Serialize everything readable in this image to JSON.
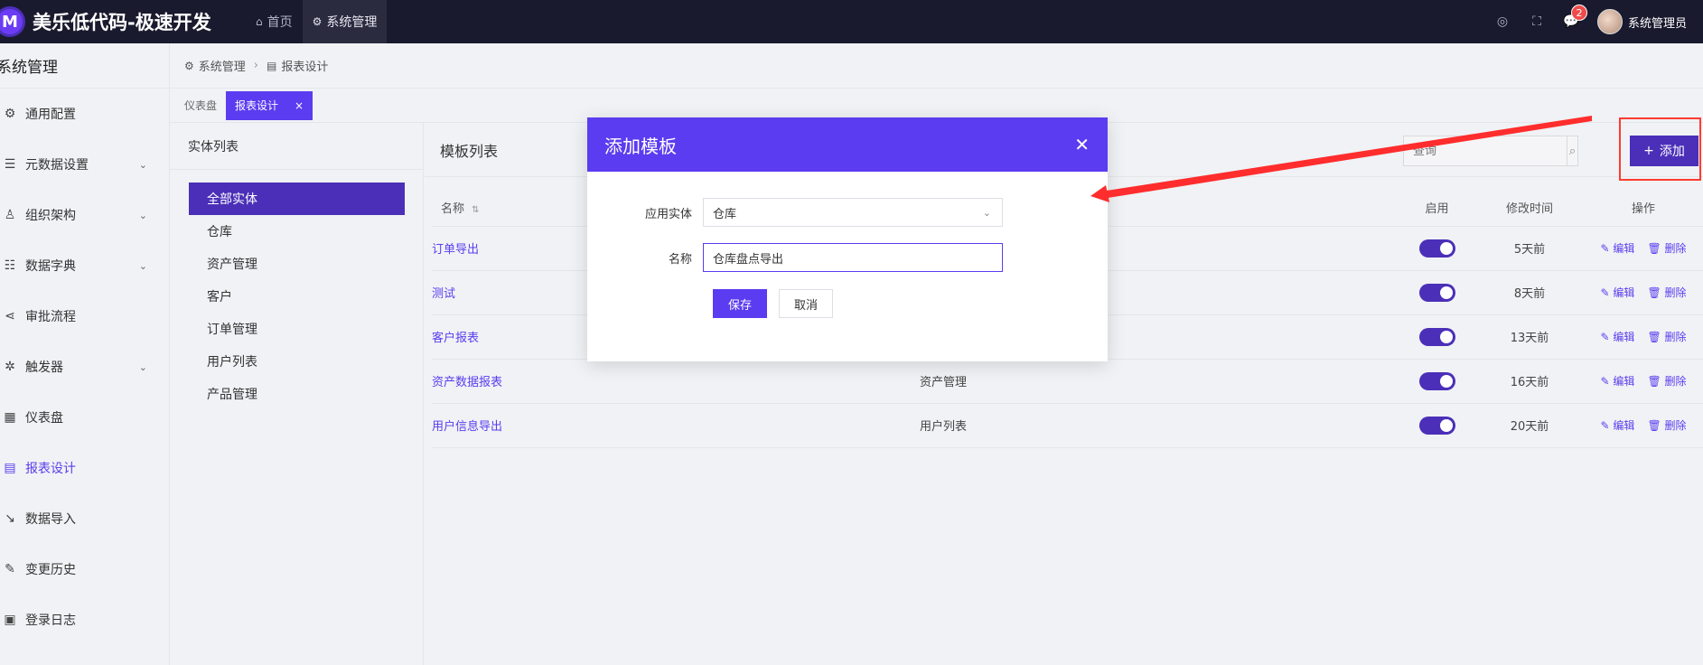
{
  "app": {
    "logo_letter": "M",
    "title": "美乐低代码-极速开发"
  },
  "topnav": [
    {
      "label": "首页",
      "icon": "home-icon"
    },
    {
      "label": "系统管理",
      "icon": "gear-icon"
    }
  ],
  "topright": {
    "notification_count": "2",
    "user_name": "系统管理员"
  },
  "sidebar": {
    "title": "系统管理",
    "items": [
      {
        "label": "通用配置",
        "icon": "gear-icon",
        "has_children": false
      },
      {
        "label": "元数据设置",
        "icon": "database-icon",
        "has_children": true
      },
      {
        "label": "组织架构",
        "icon": "user-icon",
        "has_children": true
      },
      {
        "label": "数据字典",
        "icon": "sliders-icon",
        "has_children": true
      },
      {
        "label": "审批流程",
        "icon": "share-icon",
        "has_children": false
      },
      {
        "label": "触发器",
        "icon": "cog-icon",
        "has_children": true
      },
      {
        "label": "仪表盘",
        "icon": "grid-icon",
        "has_children": false
      },
      {
        "label": "报表设计",
        "icon": "report-icon",
        "has_children": false,
        "active": true
      },
      {
        "label": "数据导入",
        "icon": "import-icon",
        "has_children": false
      },
      {
        "label": "变更历史",
        "icon": "edit-icon",
        "has_children": false
      },
      {
        "label": "登录日志",
        "icon": "log-icon",
        "has_children": false
      }
    ]
  },
  "breadcrumb": {
    "root": "系统管理",
    "current": "报表设计"
  },
  "tabs": [
    {
      "label": "仪表盘",
      "active": false
    },
    {
      "label": "报表设计",
      "active": true
    }
  ],
  "entity_panel": {
    "title": "实体列表",
    "items": [
      "全部实体",
      "仓库",
      "资产管理",
      "客户",
      "订单管理",
      "用户列表",
      "产品管理"
    ]
  },
  "template_list": {
    "title": "模板列表",
    "search_placeholder": "查询",
    "add_label": "添加",
    "columns": {
      "name": "名称",
      "enabled": "启用",
      "modified": "修改时间",
      "ops": "操作"
    },
    "edit_label": "编辑",
    "delete_label": "删除",
    "rows": [
      {
        "name": "订单导出",
        "entity": "",
        "enabled": true,
        "modified": "5天前"
      },
      {
        "name": "测试",
        "entity": "",
        "enabled": true,
        "modified": "8天前"
      },
      {
        "name": "客户报表",
        "entity": "",
        "enabled": true,
        "modified": "13天前"
      },
      {
        "name": "资产数据报表",
        "entity": "资产管理",
        "enabled": true,
        "modified": "16天前"
      },
      {
        "name": "用户信息导出",
        "entity": "用户列表",
        "enabled": true,
        "modified": "20天前"
      }
    ]
  },
  "modal": {
    "title": "添加模板",
    "entity_label": "应用实体",
    "entity_value": "仓库",
    "name_label": "名称",
    "name_value": "仓库盘点导出",
    "save_label": "保存",
    "cancel_label": "取消"
  },
  "colors": {
    "primary": "#5b3cf0",
    "topbar": "#1a1a2e",
    "annotation": "#ff3b30"
  }
}
